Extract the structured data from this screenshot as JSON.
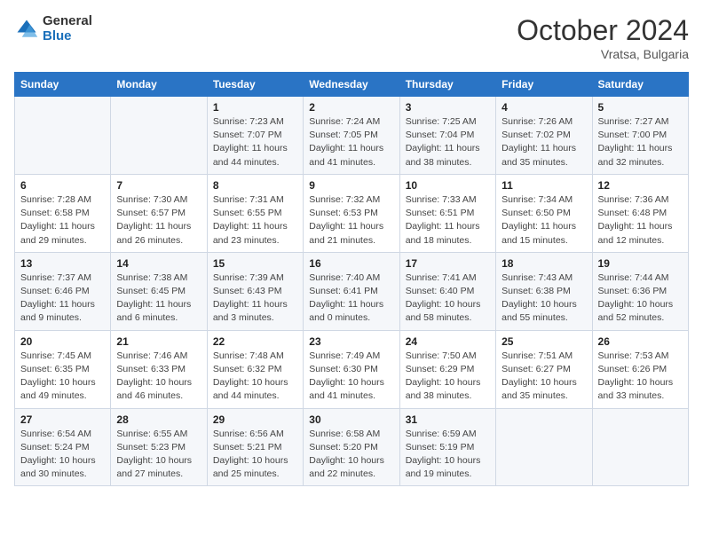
{
  "header": {
    "logo_general": "General",
    "logo_blue": "Blue",
    "month_title": "October 2024",
    "location": "Vratsa, Bulgaria"
  },
  "days_of_week": [
    "Sunday",
    "Monday",
    "Tuesday",
    "Wednesday",
    "Thursday",
    "Friday",
    "Saturday"
  ],
  "weeks": [
    [
      {
        "day": "",
        "sunrise": "",
        "sunset": "",
        "daylight": ""
      },
      {
        "day": "",
        "sunrise": "",
        "sunset": "",
        "daylight": ""
      },
      {
        "day": "1",
        "sunrise": "Sunrise: 7:23 AM",
        "sunset": "Sunset: 7:07 PM",
        "daylight": "Daylight: 11 hours and 44 minutes."
      },
      {
        "day": "2",
        "sunrise": "Sunrise: 7:24 AM",
        "sunset": "Sunset: 7:05 PM",
        "daylight": "Daylight: 11 hours and 41 minutes."
      },
      {
        "day": "3",
        "sunrise": "Sunrise: 7:25 AM",
        "sunset": "Sunset: 7:04 PM",
        "daylight": "Daylight: 11 hours and 38 minutes."
      },
      {
        "day": "4",
        "sunrise": "Sunrise: 7:26 AM",
        "sunset": "Sunset: 7:02 PM",
        "daylight": "Daylight: 11 hours and 35 minutes."
      },
      {
        "day": "5",
        "sunrise": "Sunrise: 7:27 AM",
        "sunset": "Sunset: 7:00 PM",
        "daylight": "Daylight: 11 hours and 32 minutes."
      }
    ],
    [
      {
        "day": "6",
        "sunrise": "Sunrise: 7:28 AM",
        "sunset": "Sunset: 6:58 PM",
        "daylight": "Daylight: 11 hours and 29 minutes."
      },
      {
        "day": "7",
        "sunrise": "Sunrise: 7:30 AM",
        "sunset": "Sunset: 6:57 PM",
        "daylight": "Daylight: 11 hours and 26 minutes."
      },
      {
        "day": "8",
        "sunrise": "Sunrise: 7:31 AM",
        "sunset": "Sunset: 6:55 PM",
        "daylight": "Daylight: 11 hours and 23 minutes."
      },
      {
        "day": "9",
        "sunrise": "Sunrise: 7:32 AM",
        "sunset": "Sunset: 6:53 PM",
        "daylight": "Daylight: 11 hours and 21 minutes."
      },
      {
        "day": "10",
        "sunrise": "Sunrise: 7:33 AM",
        "sunset": "Sunset: 6:51 PM",
        "daylight": "Daylight: 11 hours and 18 minutes."
      },
      {
        "day": "11",
        "sunrise": "Sunrise: 7:34 AM",
        "sunset": "Sunset: 6:50 PM",
        "daylight": "Daylight: 11 hours and 15 minutes."
      },
      {
        "day": "12",
        "sunrise": "Sunrise: 7:36 AM",
        "sunset": "Sunset: 6:48 PM",
        "daylight": "Daylight: 11 hours and 12 minutes."
      }
    ],
    [
      {
        "day": "13",
        "sunrise": "Sunrise: 7:37 AM",
        "sunset": "Sunset: 6:46 PM",
        "daylight": "Daylight: 11 hours and 9 minutes."
      },
      {
        "day": "14",
        "sunrise": "Sunrise: 7:38 AM",
        "sunset": "Sunset: 6:45 PM",
        "daylight": "Daylight: 11 hours and 6 minutes."
      },
      {
        "day": "15",
        "sunrise": "Sunrise: 7:39 AM",
        "sunset": "Sunset: 6:43 PM",
        "daylight": "Daylight: 11 hours and 3 minutes."
      },
      {
        "day": "16",
        "sunrise": "Sunrise: 7:40 AM",
        "sunset": "Sunset: 6:41 PM",
        "daylight": "Daylight: 11 hours and 0 minutes."
      },
      {
        "day": "17",
        "sunrise": "Sunrise: 7:41 AM",
        "sunset": "Sunset: 6:40 PM",
        "daylight": "Daylight: 10 hours and 58 minutes."
      },
      {
        "day": "18",
        "sunrise": "Sunrise: 7:43 AM",
        "sunset": "Sunset: 6:38 PM",
        "daylight": "Daylight: 10 hours and 55 minutes."
      },
      {
        "day": "19",
        "sunrise": "Sunrise: 7:44 AM",
        "sunset": "Sunset: 6:36 PM",
        "daylight": "Daylight: 10 hours and 52 minutes."
      }
    ],
    [
      {
        "day": "20",
        "sunrise": "Sunrise: 7:45 AM",
        "sunset": "Sunset: 6:35 PM",
        "daylight": "Daylight: 10 hours and 49 minutes."
      },
      {
        "day": "21",
        "sunrise": "Sunrise: 7:46 AM",
        "sunset": "Sunset: 6:33 PM",
        "daylight": "Daylight: 10 hours and 46 minutes."
      },
      {
        "day": "22",
        "sunrise": "Sunrise: 7:48 AM",
        "sunset": "Sunset: 6:32 PM",
        "daylight": "Daylight: 10 hours and 44 minutes."
      },
      {
        "day": "23",
        "sunrise": "Sunrise: 7:49 AM",
        "sunset": "Sunset: 6:30 PM",
        "daylight": "Daylight: 10 hours and 41 minutes."
      },
      {
        "day": "24",
        "sunrise": "Sunrise: 7:50 AM",
        "sunset": "Sunset: 6:29 PM",
        "daylight": "Daylight: 10 hours and 38 minutes."
      },
      {
        "day": "25",
        "sunrise": "Sunrise: 7:51 AM",
        "sunset": "Sunset: 6:27 PM",
        "daylight": "Daylight: 10 hours and 35 minutes."
      },
      {
        "day": "26",
        "sunrise": "Sunrise: 7:53 AM",
        "sunset": "Sunset: 6:26 PM",
        "daylight": "Daylight: 10 hours and 33 minutes."
      }
    ],
    [
      {
        "day": "27",
        "sunrise": "Sunrise: 6:54 AM",
        "sunset": "Sunset: 5:24 PM",
        "daylight": "Daylight: 10 hours and 30 minutes."
      },
      {
        "day": "28",
        "sunrise": "Sunrise: 6:55 AM",
        "sunset": "Sunset: 5:23 PM",
        "daylight": "Daylight: 10 hours and 27 minutes."
      },
      {
        "day": "29",
        "sunrise": "Sunrise: 6:56 AM",
        "sunset": "Sunset: 5:21 PM",
        "daylight": "Daylight: 10 hours and 25 minutes."
      },
      {
        "day": "30",
        "sunrise": "Sunrise: 6:58 AM",
        "sunset": "Sunset: 5:20 PM",
        "daylight": "Daylight: 10 hours and 22 minutes."
      },
      {
        "day": "31",
        "sunrise": "Sunrise: 6:59 AM",
        "sunset": "Sunset: 5:19 PM",
        "daylight": "Daylight: 10 hours and 19 minutes."
      },
      {
        "day": "",
        "sunrise": "",
        "sunset": "",
        "daylight": ""
      },
      {
        "day": "",
        "sunrise": "",
        "sunset": "",
        "daylight": ""
      }
    ]
  ]
}
